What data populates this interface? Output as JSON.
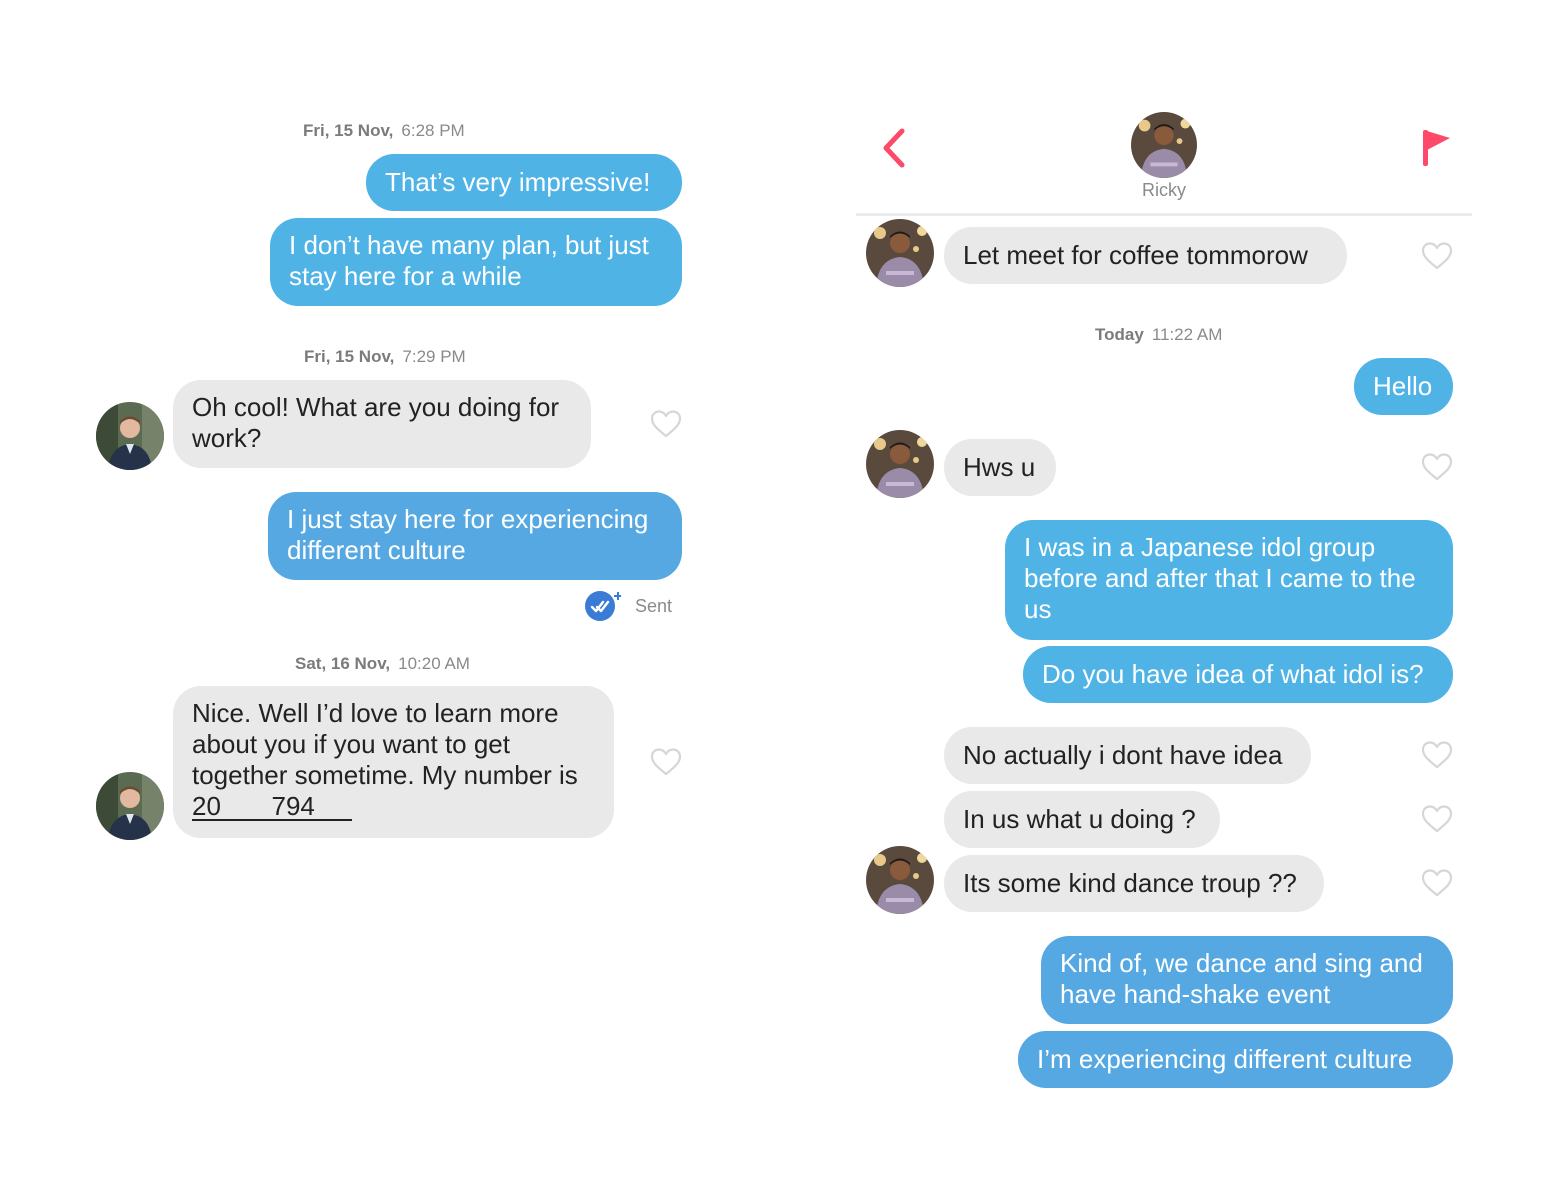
{
  "colors": {
    "outgoing_bubble": "#4fb3e6",
    "incoming_bubble": "#e9e9e9",
    "accent_red": "#fd4a68",
    "read_receipt": "#3a7bd5"
  },
  "left_chat": {
    "messages": [
      {
        "type": "timestamp",
        "day": "Fri, 15 Nov,",
        "time": "6:28 PM"
      },
      {
        "type": "outgoing",
        "text": "That’s very impressive!"
      },
      {
        "type": "outgoing",
        "text": "I don’t have many plan, but just stay here for a while"
      },
      {
        "type": "timestamp",
        "day": "Fri, 15 Nov,",
        "time": "7:29 PM"
      },
      {
        "type": "incoming",
        "text": "Oh cool! What are you doing for work?"
      },
      {
        "type": "outgoing",
        "text": "I just stay here for experiencing different culture"
      },
      {
        "type": "status",
        "text": "Sent",
        "icon": "double-check-icon"
      },
      {
        "type": "timestamp",
        "day": "Sat, 16 Nov,",
        "time": "10:20 AM"
      },
      {
        "type": "incoming",
        "text": "Nice. Well I’d love to learn more about you if you want to get together sometime. My number is",
        "number": "20       794      "
      }
    ]
  },
  "right_chat": {
    "header": {
      "back_icon": "chevron-left-icon",
      "contact_name": "Ricky",
      "report_icon": "flag-icon"
    },
    "messages": [
      {
        "type": "incoming",
        "text": "Let meet for coffee tommorow"
      },
      {
        "type": "timestamp",
        "day": "Today",
        "time": "11:22 AM"
      },
      {
        "type": "outgoing",
        "text": "Hello"
      },
      {
        "type": "incoming",
        "text": "Hws u"
      },
      {
        "type": "outgoing",
        "text": "I was in a Japanese idol group before and after that I came to the us"
      },
      {
        "type": "outgoing",
        "text": "Do you have idea of what idol is?"
      },
      {
        "type": "incoming",
        "text": "No actually i dont have idea"
      },
      {
        "type": "incoming",
        "text": "In us what u doing ?"
      },
      {
        "type": "incoming",
        "text": "Its some kind dance troup ??"
      },
      {
        "type": "outgoing",
        "text": "Kind of, we dance and sing and have hand-shake event"
      },
      {
        "type": "outgoing",
        "text": "I’m experiencing different culture"
      }
    ]
  }
}
